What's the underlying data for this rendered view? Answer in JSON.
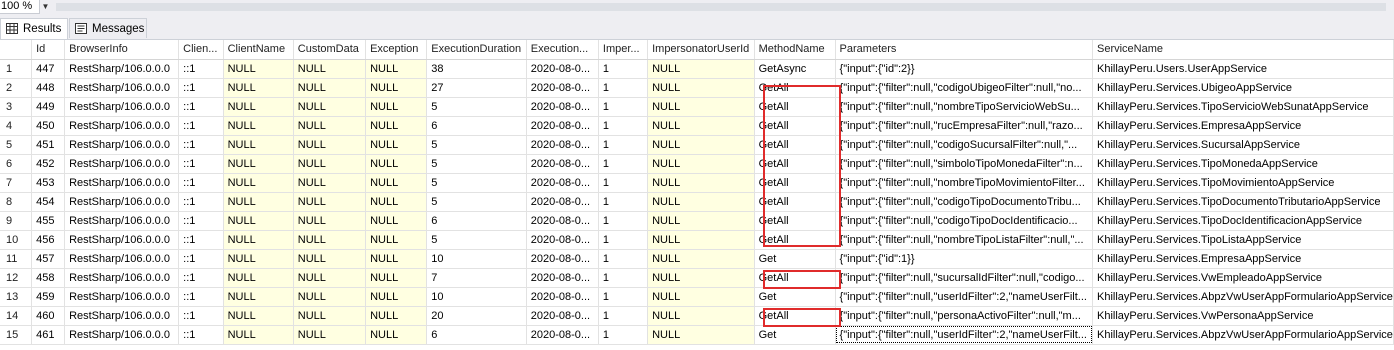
{
  "toolbar": {
    "zoom": "100 %"
  },
  "tabs": [
    {
      "label": "Results",
      "icon": "grid-icon",
      "active": true
    },
    {
      "label": "Messages",
      "icon": "messages-icon",
      "active": false
    }
  ],
  "grid": {
    "columns": [
      "Id",
      "BrowserInfo",
      "Clien...",
      "ClientName",
      "CustomData",
      "Exception",
      "ExecutionDuration",
      "Execution...",
      "Imper...",
      "ImpersonatorUserId",
      "MethodName",
      "Parameters",
      "ServiceName"
    ],
    "rows": [
      {
        "n": "1",
        "id": "447",
        "browser": "RestSharp/106.0.0.0",
        "client": "::1",
        "clientName": "NULL",
        "customData": "NULL",
        "exception": "NULL",
        "duration": "38",
        "exec": "2020-08-0...",
        "imper": "1",
        "impUser": "NULL",
        "method": "GetAsync",
        "params": "{\"input\":{\"id\":2}}",
        "service": "KhillayPeru.Users.UserAppService"
      },
      {
        "n": "2",
        "id": "448",
        "browser": "RestSharp/106.0.0.0",
        "client": "::1",
        "clientName": "NULL",
        "customData": "NULL",
        "exception": "NULL",
        "duration": "27",
        "exec": "2020-08-0...",
        "imper": "1",
        "impUser": "NULL",
        "method": "GetAll",
        "params": "{\"input\":{\"filter\":null,\"codigoUbigeoFilter\":null,\"no...",
        "service": "KhillayPeru.Services.UbigeoAppService"
      },
      {
        "n": "3",
        "id": "449",
        "browser": "RestSharp/106.0.0.0",
        "client": "::1",
        "clientName": "NULL",
        "customData": "NULL",
        "exception": "NULL",
        "duration": "5",
        "exec": "2020-08-0...",
        "imper": "1",
        "impUser": "NULL",
        "method": "GetAll",
        "params": "{\"input\":{\"filter\":null,\"nombreTipoServicioWebSu...",
        "service": "KhillayPeru.Services.TipoServicioWebSunatAppService"
      },
      {
        "n": "4",
        "id": "450",
        "browser": "RestSharp/106.0.0.0",
        "client": "::1",
        "clientName": "NULL",
        "customData": "NULL",
        "exception": "NULL",
        "duration": "6",
        "exec": "2020-08-0...",
        "imper": "1",
        "impUser": "NULL",
        "method": "GetAll",
        "params": "{\"input\":{\"filter\":null,\"rucEmpresaFilter\":null,\"razo...",
        "service": "KhillayPeru.Services.EmpresaAppService"
      },
      {
        "n": "5",
        "id": "451",
        "browser": "RestSharp/106.0.0.0",
        "client": "::1",
        "clientName": "NULL",
        "customData": "NULL",
        "exception": "NULL",
        "duration": "5",
        "exec": "2020-08-0...",
        "imper": "1",
        "impUser": "NULL",
        "method": "GetAll",
        "params": "{\"input\":{\"filter\":null,\"codigoSucursalFilter\":null,\"...",
        "service": "KhillayPeru.Services.SucursalAppService"
      },
      {
        "n": "6",
        "id": "452",
        "browser": "RestSharp/106.0.0.0",
        "client": "::1",
        "clientName": "NULL",
        "customData": "NULL",
        "exception": "NULL",
        "duration": "5",
        "exec": "2020-08-0...",
        "imper": "1",
        "impUser": "NULL",
        "method": "GetAll",
        "params": "{\"input\":{\"filter\":null,\"simboloTipoMonedaFilter\":n...",
        "service": "KhillayPeru.Services.TipoMonedaAppService"
      },
      {
        "n": "7",
        "id": "453",
        "browser": "RestSharp/106.0.0.0",
        "client": "::1",
        "clientName": "NULL",
        "customData": "NULL",
        "exception": "NULL",
        "duration": "5",
        "exec": "2020-08-0...",
        "imper": "1",
        "impUser": "NULL",
        "method": "GetAll",
        "params": "{\"input\":{\"filter\":null,\"nombreTipoMovimientoFilter...",
        "service": "KhillayPeru.Services.TipoMovimientoAppService"
      },
      {
        "n": "8",
        "id": "454",
        "browser": "RestSharp/106.0.0.0",
        "client": "::1",
        "clientName": "NULL",
        "customData": "NULL",
        "exception": "NULL",
        "duration": "5",
        "exec": "2020-08-0...",
        "imper": "1",
        "impUser": "NULL",
        "method": "GetAll",
        "params": "{\"input\":{\"filter\":null,\"codigoTipoDocumentoTribu...",
        "service": "KhillayPeru.Services.TipoDocumentoTributarioAppService"
      },
      {
        "n": "9",
        "id": "455",
        "browser": "RestSharp/106.0.0.0",
        "client": "::1",
        "clientName": "NULL",
        "customData": "NULL",
        "exception": "NULL",
        "duration": "6",
        "exec": "2020-08-0...",
        "imper": "1",
        "impUser": "NULL",
        "method": "GetAll",
        "params": "{\"input\":{\"filter\":null,\"codigoTipoDocIdentificacio...",
        "service": "KhillayPeru.Services.TipoDocIdentificacionAppService"
      },
      {
        "n": "10",
        "id": "456",
        "browser": "RestSharp/106.0.0.0",
        "client": "::1",
        "clientName": "NULL",
        "customData": "NULL",
        "exception": "NULL",
        "duration": "5",
        "exec": "2020-08-0...",
        "imper": "1",
        "impUser": "NULL",
        "method": "GetAll",
        "params": "{\"input\":{\"filter\":null,\"nombreTipoListaFilter\":null,\"...",
        "service": "KhillayPeru.Services.TipoListaAppService"
      },
      {
        "n": "11",
        "id": "457",
        "browser": "RestSharp/106.0.0.0",
        "client": "::1",
        "clientName": "NULL",
        "customData": "NULL",
        "exception": "NULL",
        "duration": "10",
        "exec": "2020-08-0...",
        "imper": "1",
        "impUser": "NULL",
        "method": "Get",
        "params": "{\"input\":{\"id\":1}}",
        "service": "KhillayPeru.Services.EmpresaAppService"
      },
      {
        "n": "12",
        "id": "458",
        "browser": "RestSharp/106.0.0.0",
        "client": "::1",
        "clientName": "NULL",
        "customData": "NULL",
        "exception": "NULL",
        "duration": "7",
        "exec": "2020-08-0...",
        "imper": "1",
        "impUser": "NULL",
        "method": "GetAll",
        "params": "{\"input\":{\"filter\":null,\"sucursalIdFilter\":null,\"codigo...",
        "service": "KhillayPeru.Services.VwEmpleadoAppService"
      },
      {
        "n": "13",
        "id": "459",
        "browser": "RestSharp/106.0.0.0",
        "client": "::1",
        "clientName": "NULL",
        "customData": "NULL",
        "exception": "NULL",
        "duration": "10",
        "exec": "2020-08-0...",
        "imper": "1",
        "impUser": "NULL",
        "method": "Get",
        "params": "{\"input\":{\"filter\":null,\"userIdFilter\":2,\"nameUserFilt...",
        "service": "KhillayPeru.Services.AbpzVwUserAppFormularioAppService"
      },
      {
        "n": "14",
        "id": "460",
        "browser": "RestSharp/106.0.0.0",
        "client": "::1",
        "clientName": "NULL",
        "customData": "NULL",
        "exception": "NULL",
        "duration": "20",
        "exec": "2020-08-0...",
        "imper": "1",
        "impUser": "NULL",
        "method": "GetAll",
        "params": "{\"input\":{\"filter\":null,\"personaActivoFilter\":null,\"m...",
        "service": "KhillayPeru.Services.VwPersonaAppService"
      },
      {
        "n": "15",
        "id": "461",
        "browser": "RestSharp/106.0.0.0",
        "client": "::1",
        "clientName": "NULL",
        "customData": "NULL",
        "exception": "NULL",
        "duration": "6",
        "exec": "2020-08-0...",
        "imper": "1",
        "impUser": "NULL",
        "method": "Get",
        "params": "{\"input\":{\"filter\":null,\"userIdFilter\":2,\"nameUserFilt...",
        "service": "KhillayPeru.Services.AbpzVwUserAppFormularioAppService"
      }
    ]
  },
  "colors": {
    "highlight": "#e02b2b",
    "null_cell": "#ffffe1"
  }
}
